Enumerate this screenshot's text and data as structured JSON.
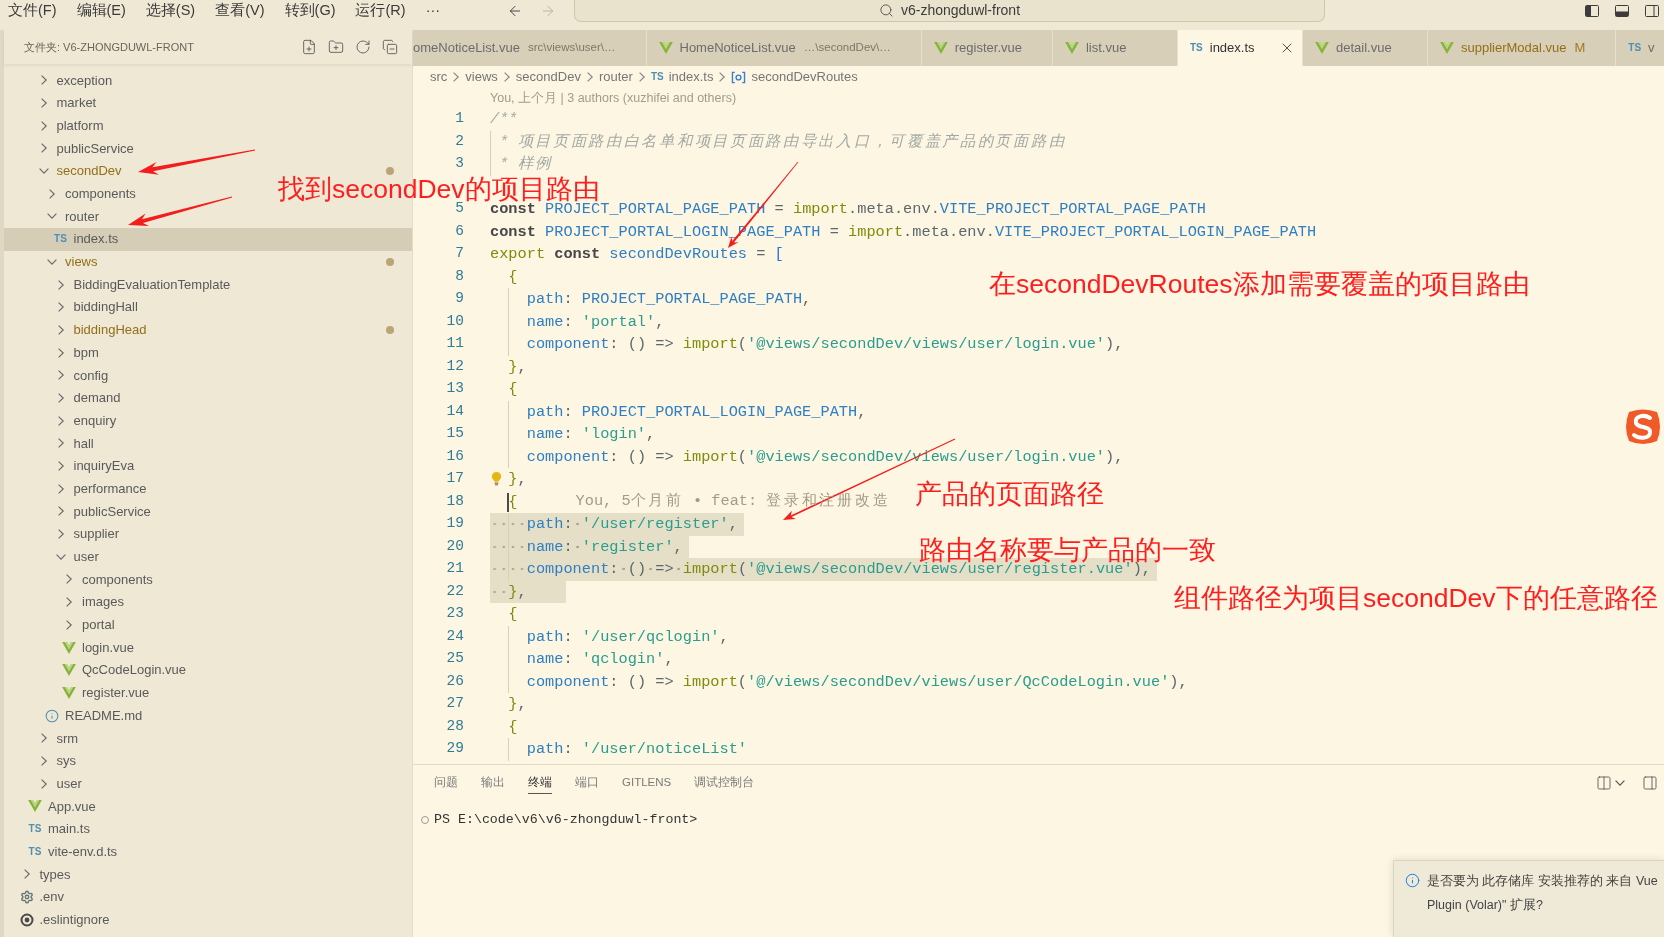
{
  "title_bar": {
    "menu": [
      "文件(F)",
      "编辑(E)",
      "选择(S)",
      "查看(V)",
      "转到(G)",
      "运行(R)",
      "···"
    ],
    "back_disabled": false,
    "forward_disabled": true,
    "command_center": "v6-zhongduwl-front"
  },
  "sidebar": {
    "title": "文件夹: V6-ZHONGDUWL-FRONT",
    "tree": [
      {
        "children": [
          {
            "children": [
              {
                "name": "exception",
                "kind": "folder",
                "expanded": false,
                "selected": false,
                "modified": false
              },
              {
                "name": "market",
                "kind": "folder",
                "expanded": false,
                "selected": false,
                "modified": false
              },
              {
                "name": "platform",
                "kind": "folder",
                "expanded": false,
                "selected": false,
                "modified": false
              },
              {
                "name": "publicService",
                "kind": "folder",
                "expanded": false,
                "selected": false,
                "modified": false
              },
              {
                "name": "secondDev",
                "kind": "folder",
                "expanded": true,
                "selected": false,
                "modified": true,
                "children": [
                  {
                    "name": "components",
                    "kind": "folder",
                    "expanded": false,
                    "selected": false,
                    "modified": false
                  },
                  {
                    "name": "router",
                    "kind": "folder",
                    "expanded": true,
                    "selected": false,
                    "modified": false,
                    "children": [
                      {
                        "name": "index.ts",
                        "kind": "ts",
                        "badge": "TS",
                        "selected": true,
                        "modified": false
                      }
                    ]
                  },
                  {
                    "name": "views",
                    "kind": "folder",
                    "expanded": true,
                    "selected": false,
                    "modified": true,
                    "children": [
                      {
                        "name": "BiddingEvaluationTemplate",
                        "kind": "folder",
                        "expanded": false,
                        "selected": false,
                        "modified": false
                      },
                      {
                        "name": "biddingHall",
                        "kind": "folder",
                        "expanded": false,
                        "selected": false,
                        "modified": false
                      },
                      {
                        "name": "biddingHead",
                        "kind": "folder",
                        "expanded": false,
                        "selected": false,
                        "modified": true
                      },
                      {
                        "name": "bpm",
                        "kind": "folder",
                        "expanded": false,
                        "selected": false,
                        "modified": false
                      },
                      {
                        "name": "config",
                        "kind": "folder",
                        "expanded": false,
                        "selected": false,
                        "modified": false
                      },
                      {
                        "name": "demand",
                        "kind": "folder",
                        "expanded": false,
                        "selected": false,
                        "modified": false
                      },
                      {
                        "name": "enquiry",
                        "kind": "folder",
                        "expanded": false,
                        "selected": false,
                        "modified": false
                      },
                      {
                        "name": "hall",
                        "kind": "folder",
                        "expanded": false,
                        "selected": false,
                        "modified": false
                      },
                      {
                        "name": "inquiryEva",
                        "kind": "folder",
                        "expanded": false,
                        "selected": false,
                        "modified": false
                      },
                      {
                        "name": "performance",
                        "kind": "folder",
                        "expanded": false,
                        "selected": false,
                        "modified": false
                      },
                      {
                        "name": "publicService",
                        "kind": "folder",
                        "expanded": false,
                        "selected": false,
                        "modified": false
                      },
                      {
                        "name": "supplier",
                        "kind": "folder",
                        "expanded": false,
                        "selected": false,
                        "modified": false
                      },
                      {
                        "name": "user",
                        "kind": "folder",
                        "expanded": true,
                        "selected": false,
                        "modified": false,
                        "children": [
                          {
                            "name": "components",
                            "kind": "folder",
                            "expanded": false,
                            "selected": false,
                            "modified": false
                          },
                          {
                            "name": "images",
                            "kind": "folder",
                            "expanded": false,
                            "selected": false,
                            "modified": false
                          },
                          {
                            "name": "portal",
                            "kind": "folder",
                            "expanded": false,
                            "selected": false,
                            "modified": false
                          },
                          {
                            "name": "login.vue",
                            "kind": "vue",
                            "selected": false,
                            "modified": false
                          },
                          {
                            "name": "QcCodeLogin.vue",
                            "kind": "vue",
                            "selected": false,
                            "modified": false
                          },
                          {
                            "name": "register.vue",
                            "kind": "vue",
                            "selected": false,
                            "modified": false
                          }
                        ]
                      }
                    ]
                  },
                  {
                    "name": "README.md",
                    "kind": "readme",
                    "selected": false,
                    "modified": false
                  }
                ]
              },
              {
                "name": "srm",
                "kind": "folder",
                "expanded": false,
                "selected": false,
                "modified": false
              },
              {
                "name": "sys",
                "kind": "folder",
                "expanded": false,
                "selected": false,
                "modified": false
              },
              {
                "name": "user",
                "kind": "folder",
                "expanded": false,
                "selected": false,
                "modified": false
              }
            ]
          },
          {
            "name": "App.vue",
            "kind": "vue",
            "selected": false,
            "modified": false
          },
          {
            "name": "main.ts",
            "kind": "ts",
            "badge": "TS",
            "selected": false,
            "modified": false
          },
          {
            "name": "vite-env.d.ts",
            "kind": "ts",
            "badge": "TS",
            "selected": false,
            "modified": false
          }
        ]
      },
      {
        "name": "types",
        "kind": "folder",
        "expanded": false,
        "selected": false,
        "modified": false
      },
      {
        "name": ".env",
        "kind": "config",
        "selected": false,
        "modified": false
      },
      {
        "name": ".eslintignore",
        "kind": "ignore",
        "selected": false,
        "modified": false
      }
    ]
  },
  "editor": {
    "tabs": [
      {
        "label": "omeNoticeList.vue",
        "description": "src\\views\\user\\…",
        "kind": "plain",
        "selected": false,
        "modified": false
      },
      {
        "label": "HomeNoticeList.vue",
        "description": "…\\secondDev\\…",
        "kind": "vue",
        "selected": false,
        "modified": false
      },
      {
        "label": "register.vue",
        "kind": "vue",
        "selected": false,
        "modified": false
      },
      {
        "label": "list.vue",
        "kind": "vue",
        "selected": false,
        "modified": false
      },
      {
        "label": "index.ts",
        "kind": "ts",
        "badge": "TS",
        "selected": true,
        "modified": false
      },
      {
        "label": "detail.vue",
        "kind": "vue",
        "selected": false,
        "modified": false
      },
      {
        "label": "supplierModal.vue",
        "kind": "vue",
        "status": "M",
        "selected": false,
        "modified": true
      },
      {
        "label": "v",
        "kind": "ts",
        "badge": "TS",
        "selected": false,
        "modified": false
      }
    ],
    "breadcrumb": [
      {
        "label": "src",
        "kind": "folder"
      },
      {
        "label": "views",
        "kind": "folder"
      },
      {
        "label": "secondDev",
        "kind": "folder"
      },
      {
        "label": "router",
        "kind": "folder"
      },
      {
        "label": "index.ts",
        "kind": "ts",
        "badge": "TS"
      },
      {
        "label": "secondDevRoutes",
        "kind": "symbol"
      }
    ],
    "blame_header": "You, 上个月 | 3 authors (xuzhifei and others)",
    "lines": [
      {
        "kind": "code",
        "number": "1",
        "highlighted": false,
        "cursor": false,
        "lightbulb": false,
        "tokens": [
          {
            "kind": "comment",
            "text": "/**"
          }
        ]
      },
      {
        "kind": "code",
        "number": "2",
        "highlighted": false,
        "cursor": false,
        "lightbulb": false,
        "tokens": [
          {
            "kind": "comment",
            "text": " * 项目页面路由白名单和项目页面路由导出入口，可覆盖产品的页面路由"
          }
        ]
      },
      {
        "kind": "code",
        "number": "3",
        "highlighted": false,
        "cursor": false,
        "lightbulb": false,
        "tokens": [
          {
            "kind": "comment",
            "text": " * 样例"
          }
        ]
      },
      {
        "kind": "covered"
      },
      {
        "kind": "code",
        "number": "5",
        "highlighted": false,
        "cursor": false,
        "lightbulb": false,
        "tokens": [
          {
            "kind": "keyword",
            "text": "const"
          },
          {
            "kind": "identifier",
            "text": " PROJECT_PORTAL_PAGE_PATH"
          },
          {
            "kind": "plain",
            "text": " = "
          },
          {
            "kind": "import",
            "text": "import"
          },
          {
            "kind": "plain",
            "text": ".meta.env."
          },
          {
            "kind": "identifier",
            "text": "VITE_PROJECT_PORTAL_PAGE_PATH"
          }
        ]
      },
      {
        "kind": "code",
        "number": "6",
        "highlighted": false,
        "cursor": false,
        "lightbulb": false,
        "tokens": [
          {
            "kind": "keyword",
            "text": "const"
          },
          {
            "kind": "identifier",
            "text": " PROJECT_PORTAL_LOGIN_PAGE_PATH"
          },
          {
            "kind": "plain",
            "text": " = "
          },
          {
            "kind": "import",
            "text": "import"
          },
          {
            "kind": "plain",
            "text": ".meta.env."
          },
          {
            "kind": "identifier",
            "text": "VITE_PROJECT_PORTAL_LOGIN_PAGE_PATH"
          }
        ]
      },
      {
        "kind": "code",
        "number": "7",
        "highlighted": false,
        "cursor": false,
        "lightbulb": false,
        "tokens": [
          {
            "kind": "import",
            "text": "export"
          },
          {
            "kind": "keyword",
            "text": " const"
          },
          {
            "kind": "identifier",
            "text": " secondDevRoutes"
          },
          {
            "kind": "plain",
            "text": " = "
          },
          {
            "kind": "bracket",
            "text": "["
          }
        ]
      },
      {
        "kind": "code",
        "number": "8",
        "highlighted": false,
        "cursor": false,
        "lightbulb": false,
        "tokens": [
          {
            "kind": "brace",
            "text": "  {"
          }
        ]
      },
      {
        "kind": "code",
        "number": "9",
        "highlighted": false,
        "cursor": false,
        "lightbulb": false,
        "tokens": [
          {
            "kind": "identifier",
            "text": "    path"
          },
          {
            "kind": "plain",
            "text": ": "
          },
          {
            "kind": "identifier",
            "text": "PROJECT_PORTAL_PAGE_PATH"
          },
          {
            "kind": "plain",
            "text": ","
          }
        ]
      },
      {
        "kind": "code",
        "number": "10",
        "highlighted": false,
        "cursor": false,
        "lightbulb": false,
        "tokens": [
          {
            "kind": "identifier",
            "text": "    name"
          },
          {
            "kind": "plain",
            "text": ": "
          },
          {
            "kind": "string",
            "text": "'portal'"
          },
          {
            "kind": "plain",
            "text": ","
          }
        ]
      },
      {
        "kind": "code",
        "number": "11",
        "highlighted": false,
        "cursor": false,
        "lightbulb": false,
        "tokens": [
          {
            "kind": "identifier",
            "text": "    component"
          },
          {
            "kind": "plain",
            "text": ": () => "
          },
          {
            "kind": "import",
            "text": "import"
          },
          {
            "kind": "plain",
            "text": "("
          },
          {
            "kind": "string",
            "text": "'@views/secondDev/views/user/login.vue'"
          },
          {
            "kind": "plain",
            "text": "),"
          }
        ]
      },
      {
        "kind": "code",
        "number": "12",
        "highlighted": false,
        "cursor": false,
        "lightbulb": false,
        "tokens": [
          {
            "kind": "brace",
            "text": "  }"
          },
          {
            "kind": "plain",
            "text": ","
          }
        ]
      },
      {
        "kind": "code",
        "number": "13",
        "highlighted": false,
        "cursor": false,
        "lightbulb": false,
        "tokens": [
          {
            "kind": "brace",
            "text": "  {"
          }
        ]
      },
      {
        "kind": "code",
        "number": "14",
        "highlighted": false,
        "cursor": false,
        "lightbulb": false,
        "tokens": [
          {
            "kind": "identifier",
            "text": "    path"
          },
          {
            "kind": "plain",
            "text": ": "
          },
          {
            "kind": "identifier",
            "text": "PROJECT_PORTAL_LOGIN_PAGE_PATH"
          },
          {
            "kind": "plain",
            "text": ","
          }
        ]
      },
      {
        "kind": "code",
        "number": "15",
        "highlighted": false,
        "cursor": false,
        "lightbulb": false,
        "tokens": [
          {
            "kind": "identifier",
            "text": "    name"
          },
          {
            "kind": "plain",
            "text": ": "
          },
          {
            "kind": "string",
            "text": "'login'"
          },
          {
            "kind": "plain",
            "text": ","
          }
        ]
      },
      {
        "kind": "code",
        "number": "16",
        "highlighted": false,
        "cursor": false,
        "lightbulb": false,
        "tokens": [
          {
            "kind": "identifier",
            "text": "    component"
          },
          {
            "kind": "plain",
            "text": ": () => "
          },
          {
            "kind": "import",
            "text": "import"
          },
          {
            "kind": "plain",
            "text": "("
          },
          {
            "kind": "string",
            "text": "'@views/secondDev/views/user/login.vue'"
          },
          {
            "kind": "plain",
            "text": "),"
          }
        ]
      },
      {
        "kind": "code",
        "number": "17",
        "highlighted": false,
        "cursor": false,
        "lightbulb": true,
        "tokens": [
          {
            "kind": "brace",
            "text": "  }"
          },
          {
            "kind": "plain",
            "text": ","
          }
        ]
      },
      {
        "kind": "code",
        "number": "18",
        "highlighted": false,
        "cursor": true,
        "lightbulb": false,
        "blame": "You, 5个月前 • feat: 登录和注册改造",
        "tokens": [
          {
            "kind": "brace",
            "text": "  {"
          }
        ]
      },
      {
        "kind": "code",
        "number": "19",
        "highlighted": true,
        "cursor": false,
        "lightbulb": false,
        "tokens": [
          {
            "kind": "identifier",
            "text": "    path"
          },
          {
            "kind": "plain",
            "text": ": "
          },
          {
            "kind": "string",
            "text": "'/user/register'"
          },
          {
            "kind": "plain",
            "text": ","
          }
        ]
      },
      {
        "kind": "code",
        "number": "20",
        "highlighted": true,
        "cursor": false,
        "lightbulb": false,
        "tokens": [
          {
            "kind": "identifier",
            "text": "    name"
          },
          {
            "kind": "plain",
            "text": ": "
          },
          {
            "kind": "string",
            "text": "'register'"
          },
          {
            "kind": "plain",
            "text": ","
          }
        ]
      },
      {
        "kind": "code",
        "number": "21",
        "highlighted": true,
        "cursor": false,
        "lightbulb": false,
        "tokens": [
          {
            "kind": "identifier",
            "text": "    component"
          },
          {
            "kind": "plain",
            "text": ": () => "
          },
          {
            "kind": "import",
            "text": "import"
          },
          {
            "kind": "plain",
            "text": "("
          },
          {
            "kind": "string",
            "text": "'@views/secondDev/views/user/register.vue'"
          },
          {
            "kind": "plain",
            "text": "),"
          }
        ]
      },
      {
        "kind": "code",
        "number": "22",
        "highlighted": true,
        "cursor": false,
        "lightbulb": false,
        "tokens": [
          {
            "kind": "brace",
            "text": "  }"
          },
          {
            "kind": "plain",
            "text": ","
          }
        ]
      },
      {
        "kind": "code",
        "number": "23",
        "highlighted": false,
        "cursor": false,
        "lightbulb": false,
        "tokens": [
          {
            "kind": "brace",
            "text": "  {"
          }
        ]
      },
      {
        "kind": "code",
        "number": "24",
        "highlighted": false,
        "cursor": false,
        "lightbulb": false,
        "tokens": [
          {
            "kind": "identifier",
            "text": "    path"
          },
          {
            "kind": "plain",
            "text": ": "
          },
          {
            "kind": "string",
            "text": "'/user/qclogin'"
          },
          {
            "kind": "plain",
            "text": ","
          }
        ]
      },
      {
        "kind": "code",
        "number": "25",
        "highlighted": false,
        "cursor": false,
        "lightbulb": false,
        "tokens": [
          {
            "kind": "identifier",
            "text": "    name"
          },
          {
            "kind": "plain",
            "text": ": "
          },
          {
            "kind": "string",
            "text": "'qclogin'"
          },
          {
            "kind": "plain",
            "text": ","
          }
        ]
      },
      {
        "kind": "code",
        "number": "26",
        "highlighted": false,
        "cursor": false,
        "lightbulb": false,
        "tokens": [
          {
            "kind": "identifier",
            "text": "    component"
          },
          {
            "kind": "plain",
            "text": ": () => "
          },
          {
            "kind": "import",
            "text": "import"
          },
          {
            "kind": "plain",
            "text": "("
          },
          {
            "kind": "string",
            "text": "'@/views/secondDev/views/user/QcCodeLogin.vue'"
          },
          {
            "kind": "plain",
            "text": "),"
          }
        ]
      },
      {
        "kind": "code",
        "number": "27",
        "highlighted": false,
        "cursor": false,
        "lightbulb": false,
        "tokens": [
          {
            "kind": "brace",
            "text": "  }"
          },
          {
            "kind": "plain",
            "text": ","
          }
        ]
      },
      {
        "kind": "code",
        "number": "28",
        "highlighted": false,
        "cursor": false,
        "lightbulb": false,
        "tokens": [
          {
            "kind": "brace",
            "text": "  {"
          }
        ]
      },
      {
        "kind": "code",
        "number": "29",
        "highlighted": false,
        "cursor": false,
        "lightbulb": false,
        "tokens": [
          {
            "kind": "identifier",
            "text": "    path"
          },
          {
            "kind": "plain",
            "text": ": "
          },
          {
            "kind": "string",
            "text": "'/user/noticeList'"
          }
        ]
      }
    ]
  },
  "panel": {
    "tabs": [
      {
        "label": "问题",
        "selected": false
      },
      {
        "label": "输出",
        "selected": false
      },
      {
        "label": "终端",
        "selected": true
      },
      {
        "label": "端口",
        "selected": false
      },
      {
        "label": "GITLENS",
        "selected": false
      },
      {
        "label": "调试控制台",
        "selected": false
      }
    ],
    "terminal_prompt": "PS E:\\code\\v6\\v6-zhongduwl-front>"
  },
  "notification": {
    "lines": [
      "是否要为 此存储库 安装推荐的 来自 Vue",
      "Plugin (Volar)\" 扩展?"
    ]
  },
  "annotations": [
    {
      "text": "找到secondDev的项目路由"
    },
    {
      "text": "在secondDevRoutes添加需要覆盖的项目路由"
    },
    {
      "text": "产品的页面路径"
    },
    {
      "text": "路由名称要与产品的一致"
    },
    {
      "text": "组件路径为项目secondDev下的任意路径"
    }
  ]
}
